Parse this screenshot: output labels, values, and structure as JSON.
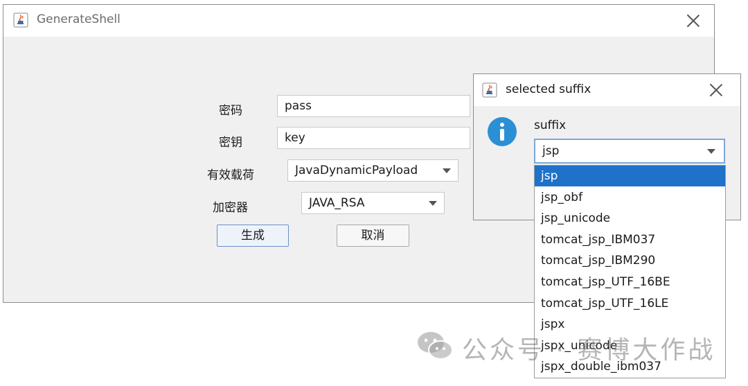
{
  "main_window": {
    "title": "GenerateShell",
    "form": {
      "password_label": "密码",
      "password_value": "pass",
      "key_label": "密钥",
      "key_value": "key",
      "payload_label": "有效载荷",
      "payload_value": "JavaDynamicPayload",
      "cryption_label": "加密器",
      "cryption_value": "JAVA_RSA",
      "generate_label": "生成",
      "cancel_label": "取消"
    }
  },
  "dialog": {
    "title": "selected suffix",
    "suffix_label": "suffix",
    "suffix_value": "jsp",
    "options": [
      "jsp",
      "jsp_obf",
      "jsp_unicode",
      "tomcat_jsp_IBM037",
      "tomcat_jsp_IBM290",
      "tomcat_jsp_UTF_16BE",
      "tomcat_jsp_UTF_16LE",
      "jspx",
      "jspx_unicode",
      "jspx_double_ibm037"
    ],
    "selected_index": 0
  },
  "watermark": {
    "text": "公众号 · 赛博大作战",
    "icon": "wechat-icon"
  },
  "colors": {
    "selection": "#1f72c9",
    "info_icon": "#2b8fd6",
    "window_bg": "#f0f0f0",
    "focus_border": "#7da7d9"
  }
}
